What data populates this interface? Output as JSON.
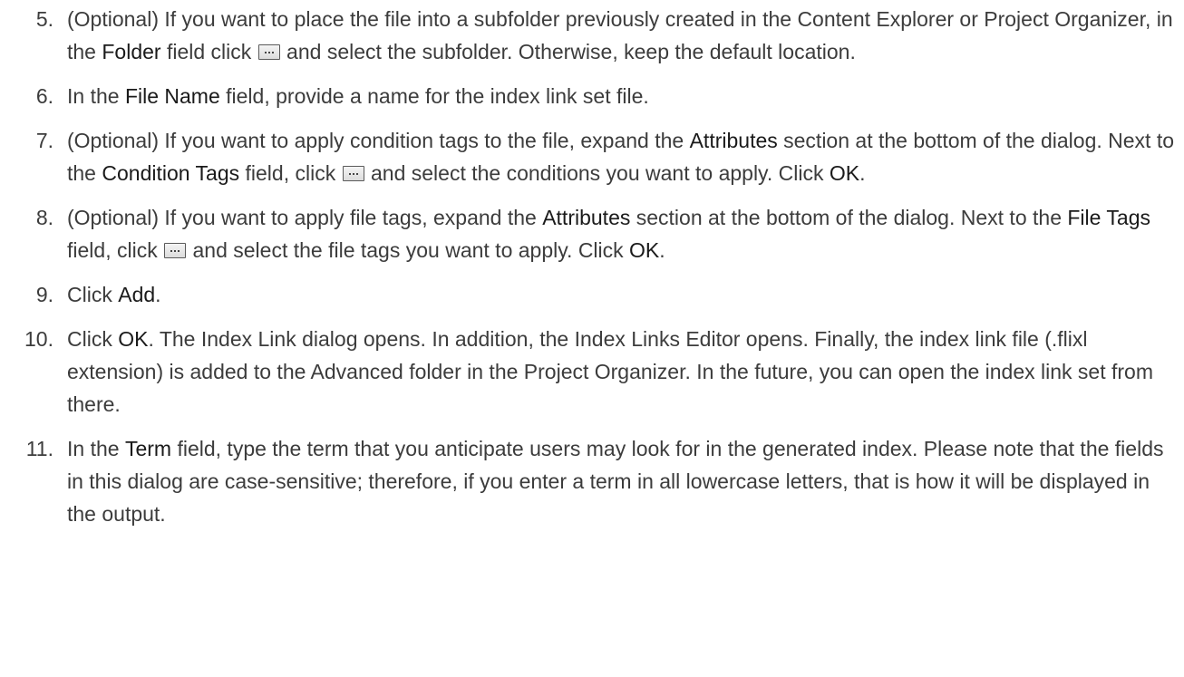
{
  "steps": [
    {
      "number": "5.",
      "parts": [
        "(Optional) If you want to place the file into a subfolder previously created in the Content Explorer or Project Organizer, in the ",
        "Folder",
        " field click ",
        " and select the subfolder. Otherwise, keep the default location."
      ]
    },
    {
      "number": "6.",
      "parts": [
        "In the ",
        "File Name",
        " field, provide a name for the index link set file."
      ]
    },
    {
      "number": "7.",
      "parts": [
        "(Optional) If you want to apply condition tags to the file, expand the ",
        "Attributes",
        " section at the bottom of the dialog. Next to the ",
        "Condition Tags",
        " field, click ",
        " and select the conditions you want to apply. Click ",
        "OK",
        "."
      ]
    },
    {
      "number": "8.",
      "parts": [
        "(Optional) If you want to apply file tags, expand the ",
        "Attributes",
        " section at the bottom of the dialog. Next to the ",
        "File Tags",
        " field, click ",
        " and select the file tags you want to apply. Click ",
        "OK",
        "."
      ]
    },
    {
      "number": "9.",
      "parts": [
        "Click ",
        "Add",
        "."
      ]
    },
    {
      "number": "10.",
      "parts": [
        "Click ",
        "OK",
        ". The Index Link dialog opens. In addition, the Index Links Editor opens. Finally, the index link file (.flixl extension) is added to the Advanced folder in the Project Organizer. In the future, you can open the index link set from there."
      ]
    },
    {
      "number": "11.",
      "parts": [
        "In the ",
        "Term",
        " field, type the term that you anticipate users may look for in the generated index. Please note that the fields in this dialog are case-sensitive; therefore, if you enter a term in all lowercase letters, that is how it will be displayed in the output."
      ]
    }
  ],
  "icons": {
    "browse_button": "ellipsis-browse-icon"
  }
}
